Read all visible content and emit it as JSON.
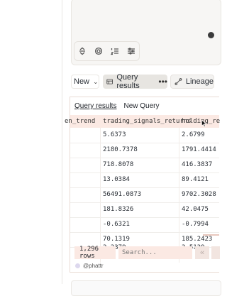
{
  "editor": {
    "tools": [
      {
        "icon": "expand-collapse-icon"
      },
      {
        "icon": "gear-icon"
      },
      {
        "icon": "numbered-list-icon"
      },
      {
        "icon": "sliders-icon"
      }
    ]
  },
  "toolbar": {
    "new_label": "New",
    "query_results_label": "Query results",
    "more_label": "•••",
    "lineage_label": "Lineage"
  },
  "results": {
    "tabs": [
      "Query results",
      "New Query"
    ],
    "columns": [
      "en_trend",
      "trading_signals_returns",
      "holding_re"
    ],
    "rows": [
      [
        "",
        "5.6373",
        "2.6799"
      ],
      [
        "",
        "2180.7378",
        "1791.4414"
      ],
      [
        "",
        "718.8078",
        "416.3837"
      ],
      [
        "",
        "13.0384",
        "89.4121"
      ],
      [
        "",
        "56491.0873",
        "9702.3028"
      ],
      [
        "",
        "181.8326",
        "42.0475"
      ],
      [
        "",
        "-0.6321",
        "-0.7994"
      ],
      [
        "",
        "70.1319",
        "185.2423"
      ],
      [
        "",
        "2.2379",
        "3.5139"
      ]
    ],
    "row_count": "1,296 rows",
    "search_placeholder": "Search...",
    "prev_label": "«",
    "credit": "@phattr"
  },
  "colors": {
    "header_bg": "#fbe9e3",
    "panel_border": "#e9dcd4",
    "active_button_bg": "#e7e5e1"
  }
}
